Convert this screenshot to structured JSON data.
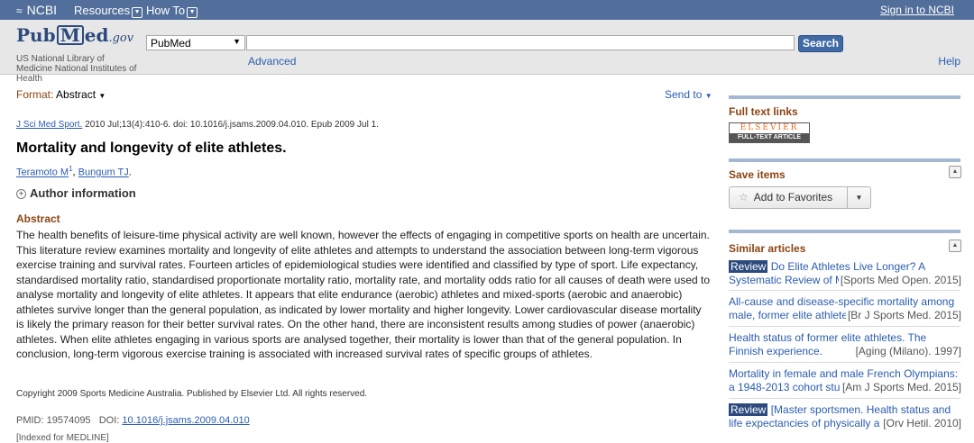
{
  "ncbi_bar": {
    "logo": "NCBI",
    "resources": "Resources",
    "how_to": "How To",
    "sign_in": "Sign in to NCBI"
  },
  "header": {
    "logo_pub": "Pub",
    "logo_m": "M",
    "logo_ed": "ed",
    "logo_gov": ".gov",
    "library_text": "US National Library of Medicine National Institutes of Health",
    "db_selected": "PubMed",
    "search_value": "",
    "search_button": "Search",
    "advanced": "Advanced",
    "help": "Help"
  },
  "article": {
    "format_label": "Format:",
    "format_value": "Abstract",
    "send_to": "Send to",
    "journal": "J Sci Med Sport.",
    "citation_rest": " 2010 Jul;13(4):410-6. doi: 10.1016/j.jsams.2009.04.010. Epub 2009 Jul 1.",
    "title": "Mortality and longevity of elite athletes.",
    "author1": "Teramoto M",
    "author1_sup": "1",
    "author_sep": ", ",
    "author2": "Bungum TJ",
    "author_end": ".",
    "author_info": "Author information",
    "abstract_heading": "Abstract",
    "abstract_text": "The health benefits of leisure-time physical activity are well known, however the effects of engaging in competitive sports on health are uncertain. This literature review examines mortality and longevity of elite athletes and attempts to understand the association between long-term vigorous exercise training and survival rates. Fourteen articles of epidemiological studies were identified and classified by type of sport. Life expectancy, standardised mortality ratio, standardised proportionate mortality ratio, mortality rate, and mortality odds ratio for all causes of death were used to analyse mortality and longevity of elite athletes. It appears that elite endurance (aerobic) athletes and mixed-sports (aerobic and anaerobic) athletes survive longer than the general population, as indicated by lower mortality and higher longevity. Lower cardiovascular disease mortality is likely the primary reason for their better survival rates. On the other hand, there are inconsistent results among studies of power (anaerobic) athletes. When elite athletes engaging in various sports are analysed together, their mortality is lower than that of the general population. In conclusion, long-term vigorous exercise training is associated with increased survival rates of specific groups of athletes.",
    "copyright": "Copyright 2009 Sports Medicine Australia. Published by Elsevier Ltd. All rights reserved.",
    "pmid_label": "PMID: 19574095",
    "doi_label": "DOI:",
    "doi_link": "10.1016/j.jsams.2009.04.010",
    "indexed": "[Indexed for MEDLINE]"
  },
  "sidebar": {
    "full_text_heading": "Full text links",
    "elsevier_top": "ELSEVIER",
    "elsevier_bottom": "FULL-TEXT ARTICLE",
    "save_heading": "Save items",
    "add_favorites": "Add to Favorites",
    "similar_heading": "Similar articles",
    "similar": [
      {
        "badge": "Review",
        "line1": " Do Elite Athletes Live Longer? A",
        "line2": "Systematic Review of M",
        "source": "[Sports Med Open. 2015]"
      },
      {
        "badge": "",
        "line1": "All-cause and disease-specific mortality among",
        "line2": "male, former elite athletes",
        "source": "[Br J Sports Med. 2015]"
      },
      {
        "badge": "",
        "line1": "Health status of former elite athletes. The",
        "line2": "Finnish experience.",
        "source": "[Aging (Milano). 1997]"
      },
      {
        "badge": "",
        "line1": "Mortality in female and male French Olympians:",
        "line2": "a 1948-2013 cohort study",
        "source": "[Am J Sports Med. 2015]"
      },
      {
        "badge": "Review",
        "line1": " [Master sportsmen. Health status and",
        "line2": "life expectancies of physically a",
        "source": "[Orv Hetil. 2010]"
      }
    ]
  },
  "colors": {
    "ncbi_bar": "#526f9b",
    "header_bg": "#e7e7e7",
    "section_heading": "#8b4513",
    "link": "#2a5db0"
  }
}
